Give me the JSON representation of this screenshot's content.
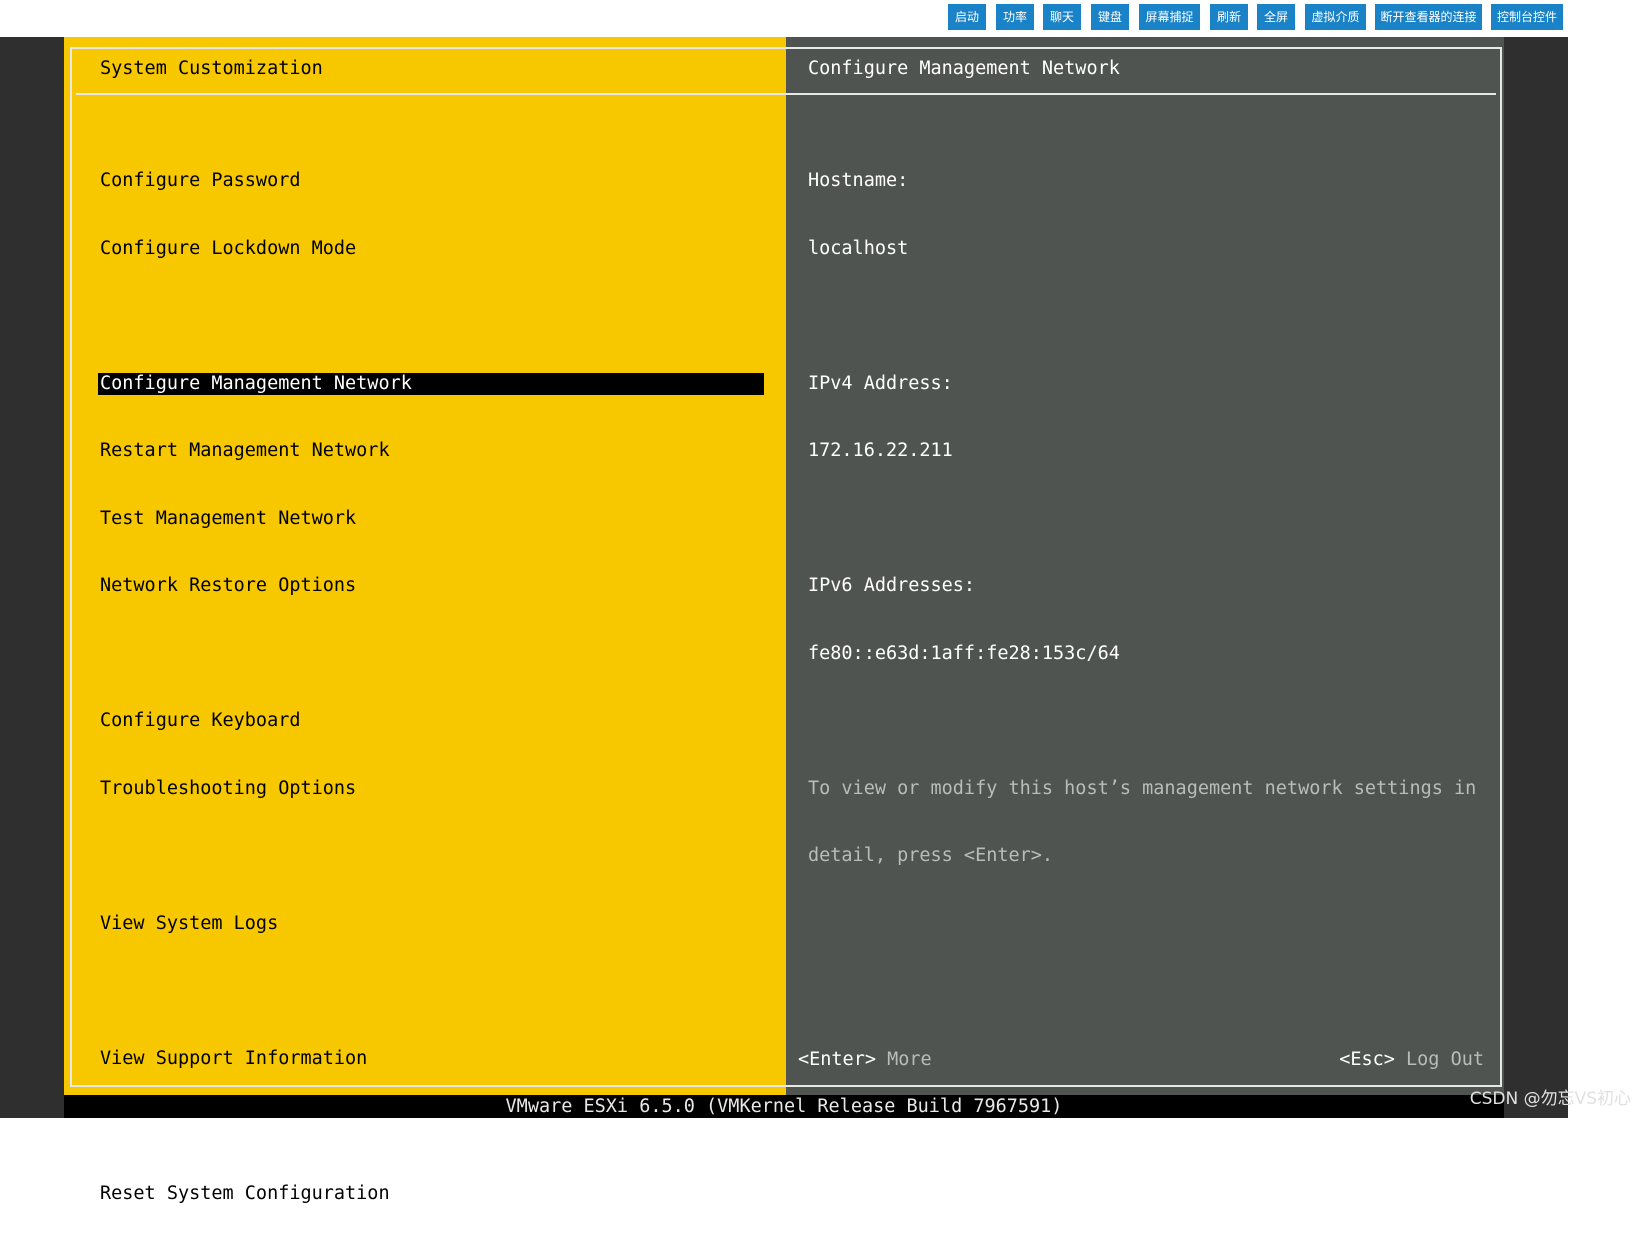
{
  "toolbar": {
    "buttons": [
      "启动",
      "功率",
      "聊天",
      "键盘",
      "屏幕捕捉",
      "刷新",
      "全屏",
      "虚拟介质",
      "断开查看器的连接",
      "控制台控件"
    ]
  },
  "left_pane": {
    "title": "System Customization",
    "menu": [
      "Configure Password",
      "Configure Lockdown Mode",
      "Configure Management Network",
      "Restart Management Network",
      "Test Management Network",
      "Network Restore Options",
      "Configure Keyboard",
      "Troubleshooting Options",
      "View System Logs",
      "View Support Information",
      "Reset System Configuration"
    ],
    "selected_index": 2
  },
  "right_pane": {
    "title": "Configure Management Network",
    "hostname_label": "Hostname:",
    "hostname_value": "localhost",
    "ipv4_label": "IPv4 Address:",
    "ipv4_value": "172.16.22.211",
    "ipv6_label": "IPv6 Addresses:",
    "ipv6_value": "fe80::e63d:1aff:fe28:153c/64",
    "hint_line1": "To view or modify this host’s management network settings in",
    "hint_line2": "detail, press <Enter>.",
    "footer_enter_key": "<Enter>",
    "footer_enter_action": "More",
    "footer_esc_key": "<Esc>",
    "footer_esc_action": "Log Out"
  },
  "status_bar": "VMware ESXi 6.5.0 (VMKernel Release Build 7967591)",
  "watermark": "CSDN @勿忘VS初心",
  "colors": {
    "left_pane_bg": "#f7c800",
    "right_pane_bg": "#4f5450",
    "toolbar_button_bg": "#1a82c6",
    "selected_item_bg": "#000000"
  }
}
